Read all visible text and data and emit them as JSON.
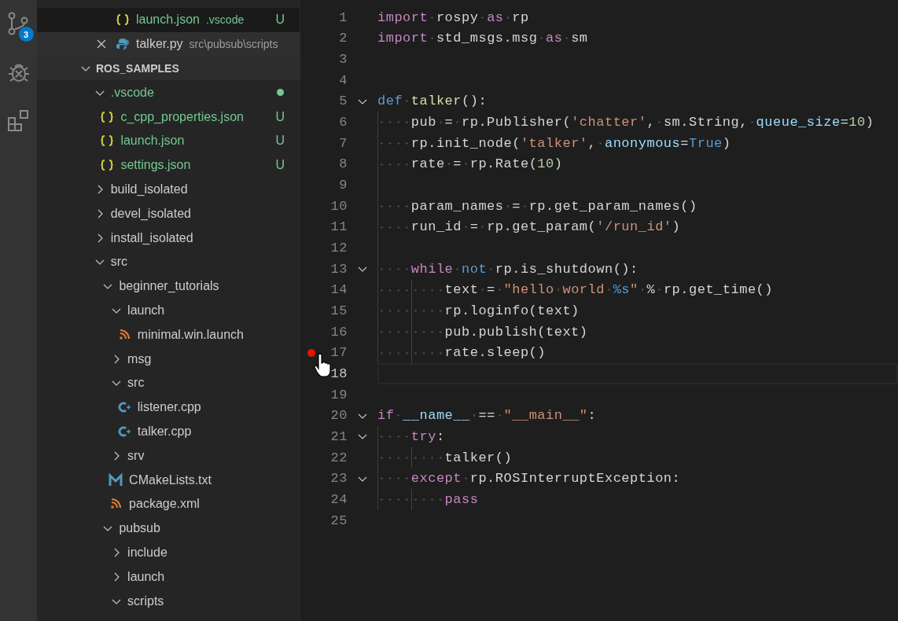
{
  "activity_bar": [
    {
      "kind": "source-control",
      "badge": "3"
    },
    {
      "kind": "debug"
    },
    {
      "kind": "extensions"
    }
  ],
  "explorer": {
    "open_editors": [
      {
        "name": "launch.json",
        "kind": "json",
        "description": ".vscode",
        "badge": "U",
        "untracked": true,
        "selected": true,
        "hovered": false
      },
      {
        "name": "talker.py",
        "kind": "python",
        "description": "src\\pubsub\\scripts",
        "untracked": false,
        "selected": false,
        "hovered": true
      }
    ],
    "root": {
      "name": "ROS_SAMPLES",
      "expanded": true,
      "children": [
        {
          "kind": "folder",
          "name": ".vscode",
          "expanded": true,
          "untracked": true,
          "dot": true,
          "children": [
            {
              "kind": "json",
              "name": "c_cpp_properties.json",
              "untracked": true,
              "badge": "U"
            },
            {
              "kind": "json",
              "name": "launch.json",
              "untracked": true,
              "badge": "U"
            },
            {
              "kind": "json",
              "name": "settings.json",
              "untracked": true,
              "badge": "U"
            }
          ]
        },
        {
          "kind": "folder",
          "name": "build_isolated",
          "expanded": false,
          "untracked": false
        },
        {
          "kind": "folder",
          "name": "devel_isolated",
          "expanded": false,
          "untracked": false
        },
        {
          "kind": "folder",
          "name": "install_isolated",
          "expanded": false,
          "untracked": false
        },
        {
          "kind": "folder",
          "name": "src",
          "expanded": true,
          "untracked": false,
          "children": [
            {
              "kind": "folder",
              "name": "beginner_tutorials",
              "expanded": true,
              "untracked": false,
              "children": [
                {
                  "kind": "folder",
                  "name": "launch",
                  "expanded": true,
                  "untracked": false,
                  "children": [
                    {
                      "kind": "rss",
                      "name": "minimal.win.launch",
                      "untracked": false
                    }
                  ]
                },
                {
                  "kind": "folder",
                  "name": "msg",
                  "expanded": false,
                  "untracked": false
                },
                {
                  "kind": "folder",
                  "name": "src",
                  "expanded": true,
                  "untracked": false,
                  "children": [
                    {
                      "kind": "cpp",
                      "name": "listener.cpp",
                      "untracked": false
                    },
                    {
                      "kind": "cpp",
                      "name": "talker.cpp",
                      "untracked": false
                    }
                  ]
                },
                {
                  "kind": "folder",
                  "name": "srv",
                  "expanded": false,
                  "untracked": false
                },
                {
                  "kind": "cmake",
                  "name": "CMakeLists.txt",
                  "untracked": false
                },
                {
                  "kind": "rss",
                  "name": "package.xml",
                  "untracked": false
                }
              ]
            },
            {
              "kind": "folder",
              "name": "pubsub",
              "expanded": true,
              "untracked": false,
              "children": [
                {
                  "kind": "folder",
                  "name": "include",
                  "expanded": false,
                  "untracked": false
                },
                {
                  "kind": "folder",
                  "name": "launch",
                  "expanded": false,
                  "untracked": false
                },
                {
                  "kind": "folder",
                  "name": "scripts",
                  "expanded": true,
                  "untracked": false
                }
              ]
            }
          ]
        }
      ]
    }
  },
  "editor": {
    "lines": [
      {
        "number": "1",
        "tokens": [
          {
            "kind": "keyword",
            "text": "import"
          },
          {
            "kind": "plain",
            "text": " rospy "
          },
          {
            "kind": "keyword",
            "text": "as"
          },
          {
            "kind": "plain",
            "text": " rp"
          }
        ]
      },
      {
        "number": "2",
        "tokens": [
          {
            "kind": "keyword",
            "text": "import"
          },
          {
            "kind": "plain",
            "text": " std_msgs.msg "
          },
          {
            "kind": "keyword",
            "text": "as"
          },
          {
            "kind": "plain",
            "text": " sm"
          }
        ]
      },
      {
        "number": "3"
      },
      {
        "number": "4"
      },
      {
        "number": "5",
        "foldable": true,
        "tokens": [
          {
            "kind": "storage",
            "text": "def "
          },
          {
            "kind": "function",
            "text": "talker"
          },
          {
            "kind": "plain",
            "text": "():"
          }
        ],
        "children": [
          {
            "number": "6",
            "tokens": [
              {
                "kind": "plain",
                "text": "pub = rp.Publisher("
              },
              {
                "kind": "string",
                "text": "'chatter'"
              },
              {
                "kind": "plain",
                "text": ", sm.String, "
              },
              {
                "kind": "param",
                "text": "queue_size"
              },
              {
                "kind": "plain",
                "text": "="
              },
              {
                "kind": "number",
                "text": "10"
              },
              {
                "kind": "plain",
                "text": ")"
              }
            ]
          },
          {
            "number": "7",
            "tokens": [
              {
                "kind": "plain",
                "text": "rp.init_node("
              },
              {
                "kind": "string",
                "text": "'talker'"
              },
              {
                "kind": "plain",
                "text": ", "
              },
              {
                "kind": "param",
                "text": "anonymous"
              },
              {
                "kind": "plain",
                "text": "="
              },
              {
                "kind": "storage",
                "text": "True"
              },
              {
                "kind": "plain",
                "text": ")"
              }
            ]
          },
          {
            "number": "8",
            "tokens": [
              {
                "kind": "plain",
                "text": "rate = rp.Rate("
              },
              {
                "kind": "number",
                "text": "10"
              },
              {
                "kind": "plain",
                "text": ")"
              }
            ]
          },
          {
            "number": "9"
          },
          {
            "number": "10",
            "tokens": [
              {
                "kind": "plain",
                "text": "param_names = rp.get_param_names()"
              }
            ]
          },
          {
            "number": "11",
            "tokens": [
              {
                "kind": "plain",
                "text": "run_id = rp.get_param("
              },
              {
                "kind": "string",
                "text": "'/run_id'"
              },
              {
                "kind": "plain",
                "text": ")"
              }
            ]
          },
          {
            "number": "12"
          },
          {
            "number": "13",
            "foldable": true,
            "tokens": [
              {
                "kind": "keyword",
                "text": "while "
              },
              {
                "kind": "storage",
                "text": "not"
              },
              {
                "kind": "plain",
                "text": " rp.is_shutdown():"
              }
            ],
            "children": [
              {
                "number": "14",
                "tokens": [
                  {
                    "kind": "plain",
                    "text": "text = "
                  },
                  {
                    "kind": "string",
                    "text": "\"hello world "
                  },
                  {
                    "kind": "storage",
                    "text": "%s"
                  },
                  {
                    "kind": "string",
                    "text": "\""
                  },
                  {
                    "kind": "plain",
                    "text": " % rp.get_time()"
                  }
                ]
              },
              {
                "number": "15",
                "tokens": [
                  {
                    "kind": "plain",
                    "text": "rp.loginfo(text)"
                  }
                ]
              },
              {
                "number": "16",
                "tokens": [
                  {
                    "kind": "plain",
                    "text": "pub.publish(text)"
                  }
                ]
              },
              {
                "number": "17",
                "breakpoint": true,
                "tokens": [
                  {
                    "kind": "plain",
                    "text": "rate.sleep()"
                  }
                ]
              }
            ]
          }
        ]
      },
      {
        "number": "18",
        "current": true
      },
      {
        "number": "19"
      },
      {
        "number": "20",
        "foldable": true,
        "tokens": [
          {
            "kind": "keyword",
            "text": "if "
          },
          {
            "kind": "param",
            "text": "__name__"
          },
          {
            "kind": "plain",
            "text": " == "
          },
          {
            "kind": "string",
            "text": "\"__main__\""
          },
          {
            "kind": "plain",
            "text": ":"
          }
        ],
        "children": [
          {
            "number": "21",
            "foldable": true,
            "tokens": [
              {
                "kind": "keyword",
                "text": "try"
              },
              {
                "kind": "plain",
                "text": ":"
              }
            ],
            "children": [
              {
                "number": "22",
                "tokens": [
                  {
                    "kind": "plain",
                    "text": "talker()"
                  }
                ]
              }
            ]
          },
          {
            "number": "23",
            "foldable": true,
            "tokens": [
              {
                "kind": "keyword",
                "text": "except"
              },
              {
                "kind": "plain",
                "text": " rp.ROSInterruptException:"
              }
            ],
            "children": [
              {
                "number": "24",
                "tokens": [
                  {
                    "kind": "keyword",
                    "text": "pass"
                  }
                ]
              }
            ]
          }
        ]
      },
      {
        "number": "25"
      }
    ]
  }
}
